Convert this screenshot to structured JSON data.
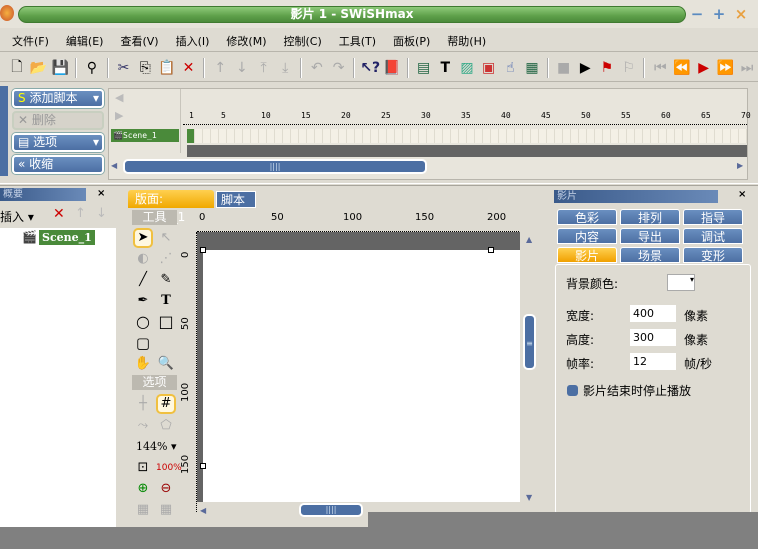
{
  "window": {
    "title": "影片 1 - SWiSHmax",
    "minimize": "−",
    "maximize": "+",
    "close": "×"
  },
  "menu": [
    "文件(F)",
    "编辑(E)",
    "查看(V)",
    "插入(I)",
    "修改(M)",
    "控制(C)",
    "工具(T)",
    "面板(P)",
    "帮助(H)"
  ],
  "toolbar": {
    "icons": [
      "new-icon",
      "open-icon",
      "save-icon",
      "find-icon",
      "cut-icon",
      "copy-icon",
      "paste-icon",
      "delete-icon",
      "move-up-icon",
      "move-down-icon",
      "move-top-icon",
      "move-bottom-icon",
      "undo-icon",
      "redo-icon",
      "help-icon",
      "book-icon",
      "insert-scene-icon",
      "insert-text-icon",
      "insert-image-icon",
      "insert-content-icon",
      "insert-button-icon",
      "insert-sprite-icon",
      "stop-icon",
      "play-icon",
      "play-timeline-icon",
      "play-effect-icon",
      "first-frame-icon",
      "prev-frame-icon",
      "play-frame-icon",
      "next-frame-icon",
      "last-frame-icon"
    ]
  },
  "timeline_buttons": {
    "add_script": "添加脚本",
    "delete": "删除",
    "options": "选项",
    "collapse": "收缩"
  },
  "timeline": {
    "ruler": [
      "1",
      "5",
      "10",
      "15",
      "20",
      "25",
      "30",
      "35",
      "40",
      "45",
      "50",
      "55",
      "60",
      "65",
      "70"
    ],
    "scene": "Scene_1"
  },
  "outline": {
    "title": "概要",
    "insert": "插入",
    "scene": "Scene_1"
  },
  "stage_tabs": {
    "layout": "版面: Scene_1",
    "script": "脚本"
  },
  "tools": {
    "title": "工具",
    "options_title": "选项",
    "zoom": "144%"
  },
  "rulers": {
    "h": [
      "0",
      "50",
      "100",
      "150",
      "200"
    ],
    "v": [
      "0",
      "50",
      "100",
      "150"
    ]
  },
  "properties": {
    "title": "影片",
    "tabs": [
      "色彩",
      "排列",
      "指导",
      "内容",
      "导出",
      "调试",
      "影片",
      "场景",
      "变形"
    ],
    "active_tab": "影片",
    "bg_label": "背景颜色:",
    "bg_color": "#ffffff",
    "width_label": "宽度:",
    "width": "400",
    "width_unit": "像素",
    "height_label": "高度:",
    "height": "300",
    "height_unit": "像素",
    "fps_label": "帧率:",
    "fps": "12",
    "fps_unit": "帧/秒",
    "stop_label": "影片结束时停止播放"
  }
}
